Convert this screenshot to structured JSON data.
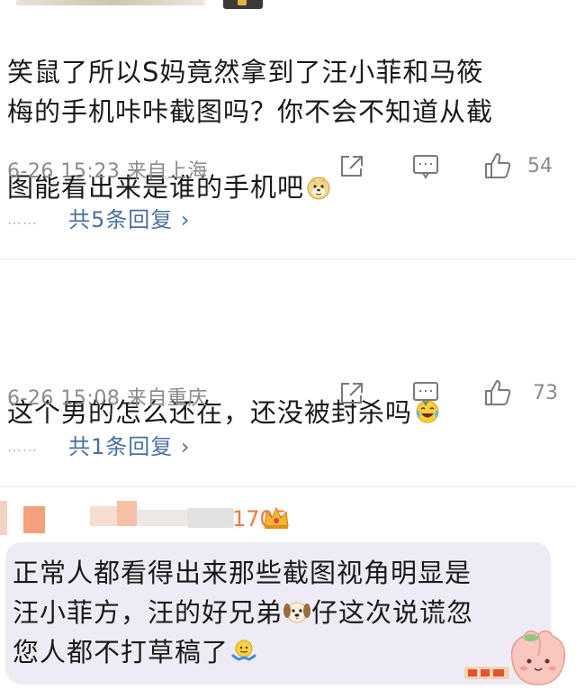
{
  "comments": [
    {
      "text": "笑鼠了所以S妈竟然拿到了汪小菲和马筱\n梅的手机咔咔截图吗？你不会不知道从截\n图能看出来是谁的手机吧",
      "emoji": "doge-emoji",
      "time": "6-26 15:23",
      "location": "来自上海",
      "likes": "54",
      "replies_label": "共5条回复",
      "dots": "……"
    },
    {
      "text": "这个男的怎么还在，还没被封杀吗",
      "emoji": "laugh-cry-emoji",
      "time": "6-26 15:08",
      "location": "来自重庆",
      "likes": "73",
      "replies_label": "共1条回复",
      "dots": "……"
    },
    {
      "username_suffix": "1705",
      "text_line1": "正常人都看得出来那些截图视角明显是",
      "text_line2_a": "汪小菲方，汪的好兄弟",
      "text_line2_b": "仔这次说谎忽",
      "text_line3": "您人都不打草稿了",
      "emoji_dog": "dog-emoji",
      "emoji_end": "shrug-emoji"
    }
  ],
  "colors": {
    "link": "#4a6fa1",
    "meta": "#8a8a8a",
    "bubble": "#efebf4",
    "username": "#f07a3a"
  },
  "icons": [
    "share-icon",
    "comment-icon",
    "like-icon",
    "chevron-right-icon",
    "crown-icon",
    "peach-mascot-icon"
  ]
}
